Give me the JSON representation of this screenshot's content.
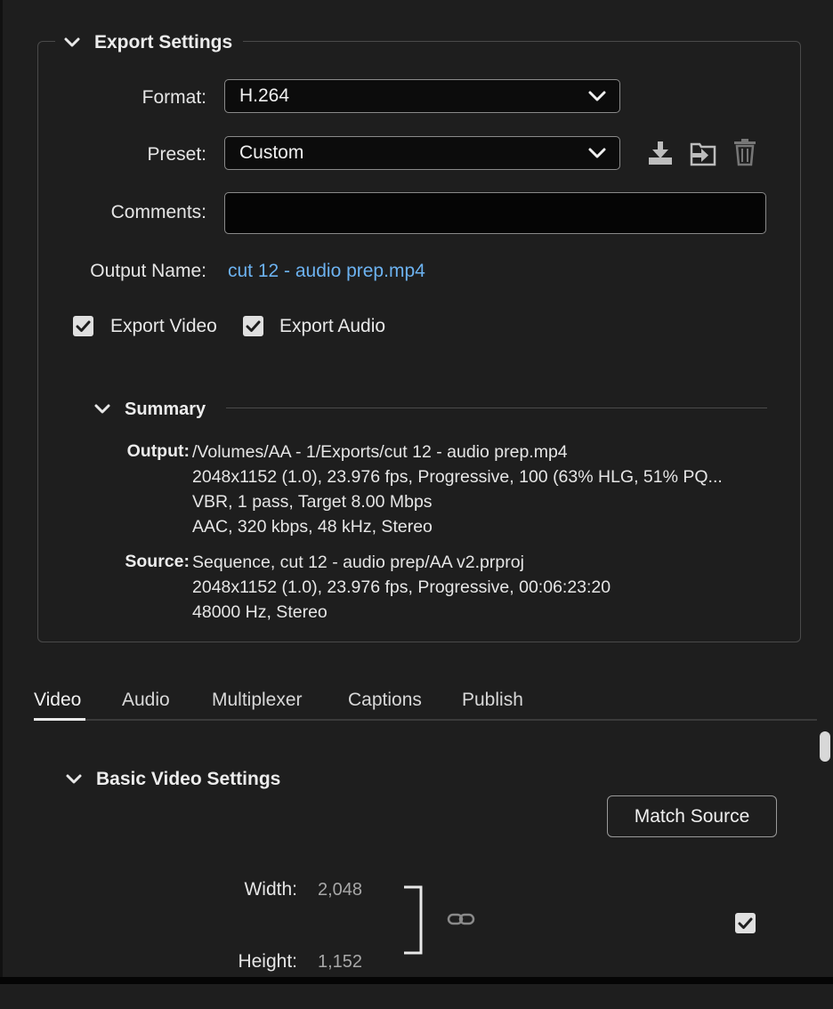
{
  "export_settings": {
    "title": "Export Settings",
    "format_label": "Format:",
    "format_value": "H.264",
    "preset_label": "Preset:",
    "preset_value": "Custom",
    "comments_label": "Comments:",
    "comments_value": "",
    "output_name_label": "Output Name:",
    "output_name_value": "cut 12 - audio prep.mp4",
    "export_video_label": "Export Video",
    "export_video_checked": true,
    "export_audio_label": "Export Audio",
    "export_audio_checked": true,
    "preset_icons": [
      "save-preset-icon",
      "import-preset-icon",
      "delete-preset-icon"
    ]
  },
  "summary": {
    "title": "Summary",
    "output_label": "Output:",
    "output_lines": [
      "/Volumes/AA - 1/Exports/cut 12 - audio prep.mp4",
      "2048x1152 (1.0), 23.976 fps, Progressive, 100 (63% HLG, 51% PQ...",
      "VBR, 1 pass, Target 8.00 Mbps",
      "AAC, 320 kbps, 48 kHz, Stereo"
    ],
    "source_label": "Source:",
    "source_lines": [
      "Sequence, cut 12 - audio prep/AA v2.prproj",
      "2048x1152 (1.0), 23.976 fps, Progressive, 00:06:23:20",
      "48000 Hz, Stereo"
    ]
  },
  "tabs": [
    {
      "label": "Video",
      "active": true
    },
    {
      "label": "Audio",
      "active": false
    },
    {
      "label": "Multiplexer",
      "active": false
    },
    {
      "label": "Captions",
      "active": false
    },
    {
      "label": "Publish",
      "active": false
    }
  ],
  "basic_video": {
    "title": "Basic Video Settings",
    "match_source_label": "Match Source",
    "width_label": "Width:",
    "width_value": "2,048",
    "height_label": "Height:",
    "height_value": "1,152",
    "link_icon": "chain-link-icon",
    "checkbox_checked": true
  },
  "colors": {
    "background": "#1e1e1e",
    "link": "#6cb2f0",
    "border": "#4a4a4a"
  }
}
